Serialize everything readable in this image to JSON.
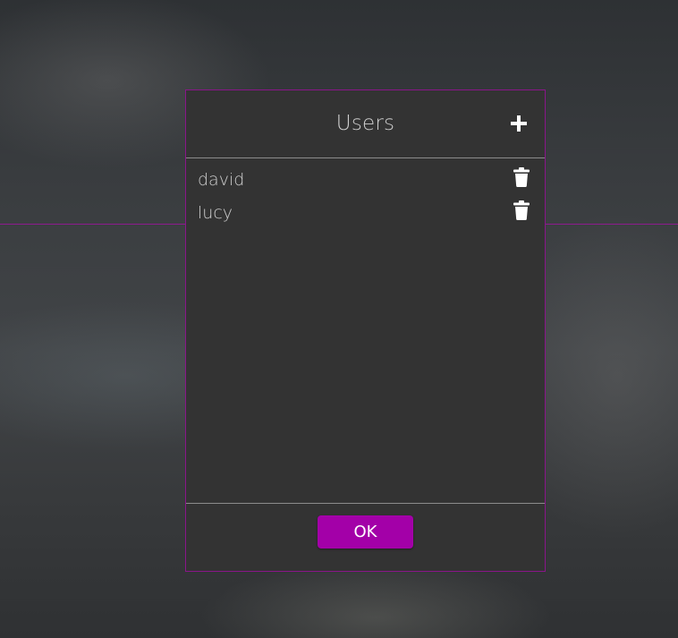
{
  "dialog": {
    "title": "Users",
    "add_icon": "plus-icon",
    "delete_icon": "trash-icon",
    "ok_label": "OK"
  },
  "users": [
    {
      "name": "david"
    },
    {
      "name": "lucy"
    }
  ],
  "colors": {
    "accent": "#a300a8",
    "dialog_background": "#333333",
    "border": "#8a158a",
    "text": "#cfcfcf"
  }
}
